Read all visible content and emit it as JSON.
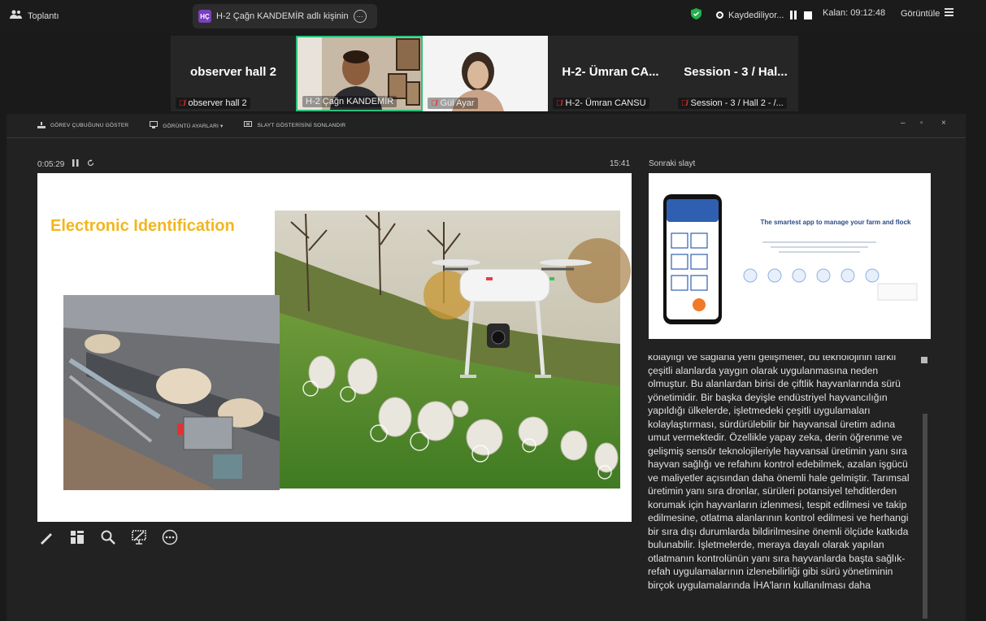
{
  "topbar": {
    "app_title": "Toplantı",
    "share": {
      "badge": "HÇ",
      "text": "H-2 Çağn KANDEMİR adlı kişinin",
      "more_glyph": "⋯"
    },
    "recording_label": "Kaydediliyor...",
    "remaining_label": "Kalan: 09:12:48",
    "view_label": "Görüntüle"
  },
  "participants": [
    {
      "big_name": "observer hall 2",
      "caption": "observer hall 2",
      "has_video": false,
      "muted": true,
      "active": false
    },
    {
      "big_name": "",
      "caption": "H-2 Çağn KANDEMİR",
      "has_video": true,
      "muted": false,
      "active": true
    },
    {
      "big_name": "",
      "caption": "Gül Ayar",
      "has_video": true,
      "muted": true,
      "active": false
    },
    {
      "big_name": "H-2- Ümran CA...",
      "caption": "H-2- Ümran CANSU",
      "has_video": false,
      "muted": true,
      "active": false
    },
    {
      "big_name": "Session - 3 / Hal...",
      "caption": "Session - 3 / Hall 2 - /...",
      "has_video": false,
      "muted": true,
      "active": false
    }
  ],
  "presenter": {
    "toolbar": {
      "taskbar": "GÖREV ÇUBUĞUNU GÖSTER",
      "display_settings": "GÖRÜNTÜ AYARLARI ▾",
      "end_show": "SLAYT GÖSTERİSİNİ SONLANDIR"
    },
    "window_controls": {
      "minimize": "–",
      "restore": "▫",
      "close": "×"
    },
    "elapsed": "0:05:29",
    "clock": "15:41",
    "next_slide_label": "Sonraki slayt",
    "slide_title": "Electronic Identification",
    "next_slide_title": "The smartest app to manage your farm and flock",
    "notes": "kolaylığı ve sağlana yeni gelişmeler, bu teknolojinin farklı çeşitli alanlarda yaygın olarak uygulanmasına neden olmuştur. Bu alanlardan birisi de çiftlik hayvanlarında sürü yönetimidir. Bir başka deyişle endüstriyel hayvancılığın yapıldığı ülkelerde, işletmedeki çeşitli uygulamaları kolaylaştırması, sürdürülebilir bir hayvansal üretim adına umut vermektedir. Özellikle yapay zeka, derin öğrenme ve gelişmiş sensör teknolojileriyle hayvansal üretimin yanı sıra hayvan sağlığı ve refahını kontrol edebilmek, azalan işgücü ve maliyetler açısından daha önemli hale gelmiştir. Tarımsal üretimin yanı sıra dronlar, sürüleri potansiyel tehditlerden korumak için hayvanların izlenmesi, tespit edilmesi ve takip edilmesine, otlatma alanlarının kontrol edilmesi ve herhangi bir sıra dışı durumlarda bildirilmesine önemli ölçüde katkıda bulunabilir. İşletmelerde, meraya dayalı olarak yapılan otlatmanın kontrolünün yanı sıra hayvanlarda başta sağlık-refah uygulamalarının izlenebilirliği gibi sürü yönetiminin birçok uygulamalarında İHA'ların kullanılması daha"
  },
  "colors": {
    "active_border": "#27c27a",
    "slide_title": "#f2b61f",
    "mic_off": "#e5302a",
    "shield": "#22b14c"
  }
}
